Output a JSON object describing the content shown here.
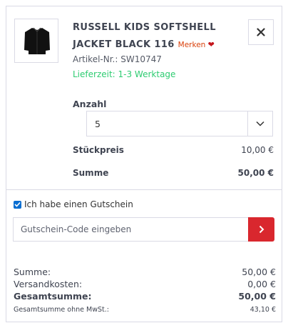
{
  "product": {
    "name": "RUSSELL KIDS SOFTSHELL JACKET BLACK 116",
    "merken_label": "Merken",
    "article_number": "Artikel-Nr.: SW10747",
    "delivery_time": "Lieferzeit: 1-3 Werktage",
    "remove_label": "✕",
    "image_icon": "jacket-icon"
  },
  "quantity": {
    "label": "Anzahl",
    "selected": "5"
  },
  "prices": {
    "unit_price_label": "Stückpreis",
    "unit_price_value": "10,00 €",
    "sum_label": "Summe",
    "sum_value": "50,00 €"
  },
  "voucher": {
    "checkbox_label": "Ich habe einen Gutschein",
    "checked": true,
    "input_placeholder": "Gutschein-Code eingeben",
    "submit_icon": "chevron-right-icon"
  },
  "summary": {
    "subtotal_label": "Summe:",
    "subtotal_value": "50,00 €",
    "shipping_label": "Versandkosten:",
    "shipping_value": "0,00 €",
    "total_label": "Gesamtsumme:",
    "total_value": "50,00 €",
    "net_label": "Gesamtsumme ohne MwSt.:",
    "net_value": "43,10 €"
  },
  "colors": {
    "accent_red": "#d9272e",
    "delivery_green": "#2ecc71",
    "merken_orange": "#d9400b",
    "checkbox_blue": "#0a6ed1"
  }
}
